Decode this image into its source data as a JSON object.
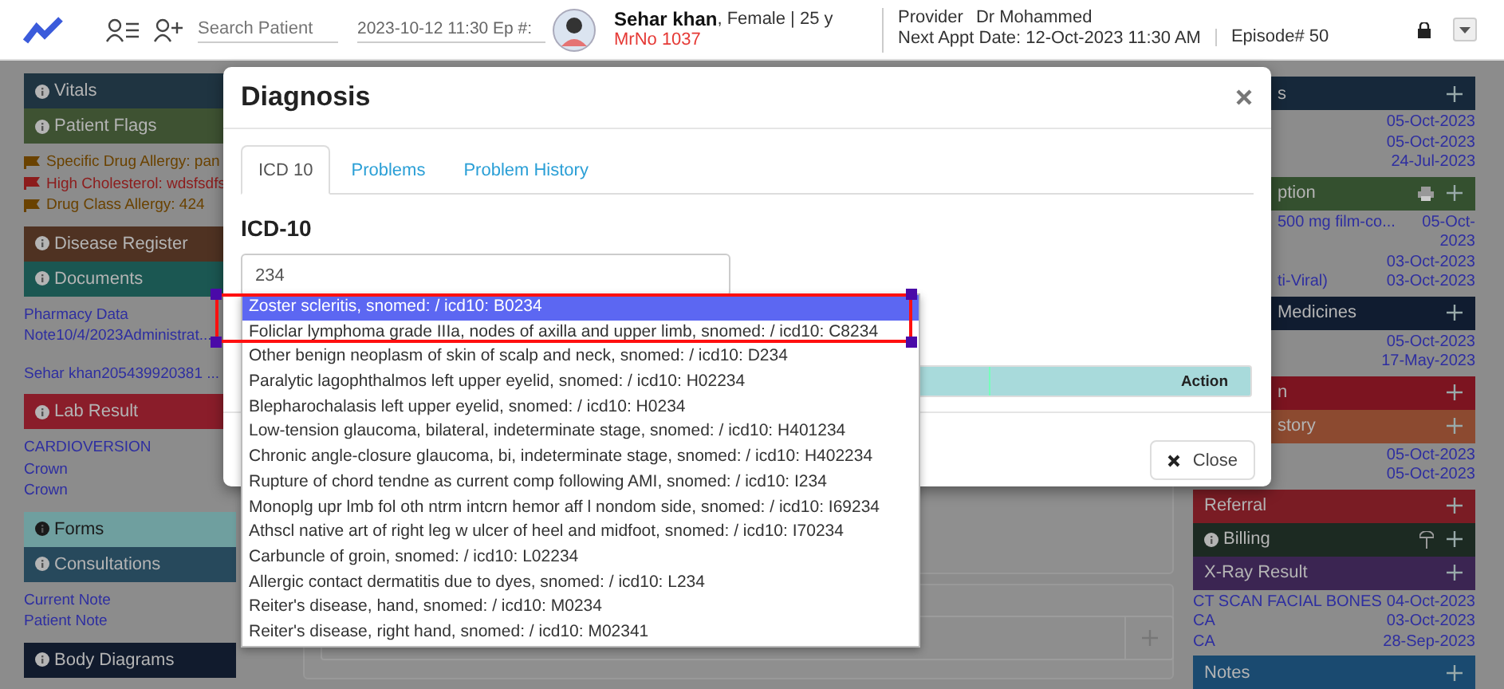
{
  "topbar": {
    "search": {
      "placeholder": "Search Patient"
    },
    "episode_field": {
      "value": "2023-10-12 11:30 Ep #:"
    },
    "patient": {
      "name": "Sehar khan",
      "details": ", Female | 25 y",
      "mrno": "MrNo 1037"
    },
    "provider": {
      "label": "Provider",
      "name": "Dr Mohammed"
    },
    "next_appt": "Next Appt Date: 12-Oct-2023 11:30 AM",
    "episode": "Episode# 50"
  },
  "left_sections": [
    {
      "title": "Vitals",
      "color": "#1f3441"
    },
    {
      "title": "Patient Flags",
      "color": "#3e5232",
      "items": [
        {
          "kind": "flag",
          "text": "Specific Drug Allergy: pan",
          "color": "#6a4200"
        },
        {
          "kind": "flag",
          "text": "High Cholesterol: wdsfsdfs",
          "color": "#8c1c1c"
        },
        {
          "kind": "flag",
          "text": "Drug Class Allergy: 424",
          "color": "#6a4200"
        }
      ]
    },
    {
      "title": "Disease Register",
      "color": "#4f3222"
    },
    {
      "title": "Documents",
      "color": "#1b5752",
      "items": [
        {
          "kind": "link",
          "text": "Pharmacy Data"
        },
        {
          "kind": "link",
          "text": "Note10/4/2023Administrat..."
        },
        {
          "kind": "link",
          "text": "Sehar khan205439920381 ..."
        }
      ]
    },
    {
      "title": "Lab Result",
      "color": "#8a1d2a",
      "items": [
        {
          "kind": "link",
          "text": "CARDIOVERSION"
        },
        {
          "kind": "link",
          "text": "Crown"
        },
        {
          "kind": "link",
          "text": "Crown"
        }
      ]
    },
    {
      "title": "Forms",
      "color": "#6f9f9f"
    },
    {
      "title": "Consultations",
      "color": "#27495c",
      "items": [
        {
          "kind": "link",
          "text": "Current Note"
        },
        {
          "kind": "link",
          "text": "Patient Note"
        }
      ]
    },
    {
      "title": "Body Diagrams",
      "color": "#111b2d"
    }
  ],
  "right_sections": [
    {
      "title": "s",
      "color": "#16283a",
      "partly_covered": true,
      "rows": [
        {
          "date": "05-Oct-2023"
        },
        {
          "date": "05-Oct-2023"
        },
        {
          "date": "24-Jul-2023"
        }
      ]
    },
    {
      "title": "ption",
      "color": "#34502f",
      "partly_covered": true,
      "print": true,
      "rows": [
        {
          "label": "500 mg film-co...",
          "date": "05-Oct-2023"
        },
        {
          "date": "03-Oct-2023"
        },
        {
          "label": "ti-Viral)",
          "date": "03-Oct-2023"
        }
      ]
    },
    {
      "title": "Medicines",
      "color": "#101c30",
      "partly_covered": true,
      "rows": [
        {
          "date": "05-Oct-2023"
        },
        {
          "date": "17-May-2023"
        }
      ]
    },
    {
      "title": "n",
      "color": "#7c1420",
      "partly_covered": true
    },
    {
      "title": "story",
      "color": "#8c4a30",
      "partly_covered": true,
      "rows": [
        {
          "date": "05-Oct-2023"
        },
        {
          "date": "05-Oct-2023"
        }
      ]
    },
    {
      "title": "Referral",
      "color": "#7a1c24"
    },
    {
      "title": "Billing",
      "color": "#1c2a22",
      "info": true,
      "pin": true
    },
    {
      "title": "X-Ray Result",
      "color": "#3b2552",
      "rows": [
        {
          "label": "CT SCAN FACIAL BONES",
          "date": "04-Oct-2023"
        },
        {
          "label": "CA",
          "date": "03-Oct-2023"
        },
        {
          "label": "CA",
          "date": "28-Sep-2023"
        }
      ]
    },
    {
      "title": "Notes",
      "color": "#1a4a70"
    }
  ],
  "modal": {
    "title": "Diagnosis",
    "tabs": [
      {
        "label": "ICD 10",
        "selected": true
      },
      {
        "label": "Problems",
        "selected": false
      },
      {
        "label": "Problem History",
        "selected": false
      }
    ],
    "heading": "ICD-10",
    "search": {
      "value": "234"
    },
    "table": {
      "columns": [
        "Action"
      ]
    },
    "close_button": "Close",
    "options": [
      {
        "text": "Zoster scleritis, snomed: / icd10: B0234",
        "selected": true,
        "highlighted": true
      },
      {
        "text": "Foliclar lymphoma grade IIIa, nodes of axilla and upper limb, snomed: / icd10: C8234",
        "selected": false,
        "highlighted": true
      },
      {
        "text": "Other benign neoplasm of skin of scalp and neck, snomed: / icd10: D234",
        "selected": false,
        "highlighted": false
      },
      {
        "text": "Paralytic lagophthalmos left upper eyelid, snomed: / icd10: H02234",
        "selected": false,
        "highlighted": false
      },
      {
        "text": "Blepharochalasis left upper eyelid, snomed: / icd10: H0234",
        "selected": false,
        "highlighted": false
      },
      {
        "text": "Low-tension glaucoma, bilateral, indeterminate stage, snomed: / icd10: H401234",
        "selected": false,
        "highlighted": false
      },
      {
        "text": "Chronic angle-closure glaucoma, bi, indeterminate stage, snomed: / icd10: H402234",
        "selected": false,
        "highlighted": false
      },
      {
        "text": "Rupture of chord tendne as current comp following AMI, snomed: / icd10: I234",
        "selected": false,
        "highlighted": false
      },
      {
        "text": "Monoplg upr lmb fol oth ntrm intcrn hemor aff l nondom side, snomed: / icd10: I69234",
        "selected": false,
        "highlighted": false
      },
      {
        "text": "Athscl native art of right leg w ulcer of heel and midfoot, snomed: / icd10: I70234",
        "selected": false,
        "highlighted": false
      },
      {
        "text": "Carbuncle of groin, snomed: / icd10: L02234",
        "selected": false,
        "highlighted": false
      },
      {
        "text": "Allergic contact dermatitis due to dyes, snomed: / icd10: L234",
        "selected": false,
        "highlighted": false
      },
      {
        "text": "Reiter's disease, hand, snomed: / icd10: M0234",
        "selected": false,
        "highlighted": false
      },
      {
        "text": "Reiter's disease, right hand, snomed: / icd10: M02341",
        "selected": false,
        "highlighted": false
      }
    ]
  }
}
